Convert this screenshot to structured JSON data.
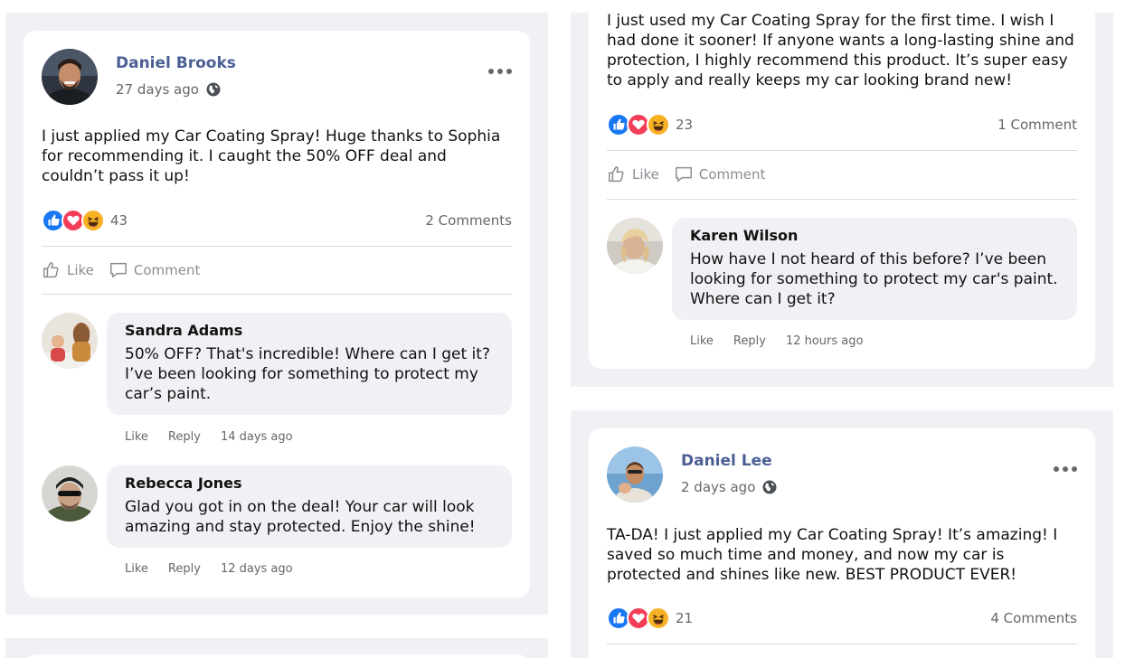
{
  "posts": [
    {
      "author": "Daniel Brooks",
      "time": "27 days ago",
      "text": "I just applied my Car Coating Spray! Huge thanks to Sophia for recommending it. I caught the 50% OFF deal and couldn’t pass it up!",
      "reaction_count": "43",
      "comments_label": "2 Comments",
      "comments": [
        {
          "author": "Sandra Adams",
          "text": "50% OFF? That's incredible! Where can I get it? I’ve been looking for something to protect my car’s paint.",
          "like": "Like",
          "reply": "Reply",
          "time": "14 days ago"
        },
        {
          "author": "Rebecca Jones",
          "text": "Glad you got in on the deal! Your car will look amazing and stay protected. Enjoy the shine!",
          "like": "Like",
          "reply": "Reply",
          "time": "12 days ago"
        }
      ]
    },
    {
      "text": "I just used my Car Coating Spray for the first time. I wish I had done it sooner! If anyone wants a long-lasting shine and protection, I highly recommend this product. It’s super easy to apply and really keeps my car looking brand new!",
      "reaction_count": "23",
      "comments_label": "1 Comment",
      "comments": [
        {
          "author": "Karen Wilson",
          "text": "How have I not heard of this before? I’ve been looking for something to protect my car's paint. Where can I get it?",
          "like": "Like",
          "reply": "Reply",
          "time": "12 hours ago"
        }
      ]
    },
    {
      "author": "Daniel Lee",
      "time": "2 days ago",
      "text": "TA-DA! I just applied my Car Coating Spray! It’s amazing! I saved so much time and money, and now my car is protected and shines like new. BEST PRODUCT EVER!",
      "reaction_count": "21",
      "comments_label": "4 Comments"
    }
  ],
  "actions": {
    "like": "Like",
    "comment": "Comment"
  },
  "colors": {
    "author": "#4b5f94",
    "like_blue": "#1877f2",
    "love_red": "#f33e58",
    "haha_yellow": "#f7b125",
    "page_bg": "#f0f1f5"
  }
}
